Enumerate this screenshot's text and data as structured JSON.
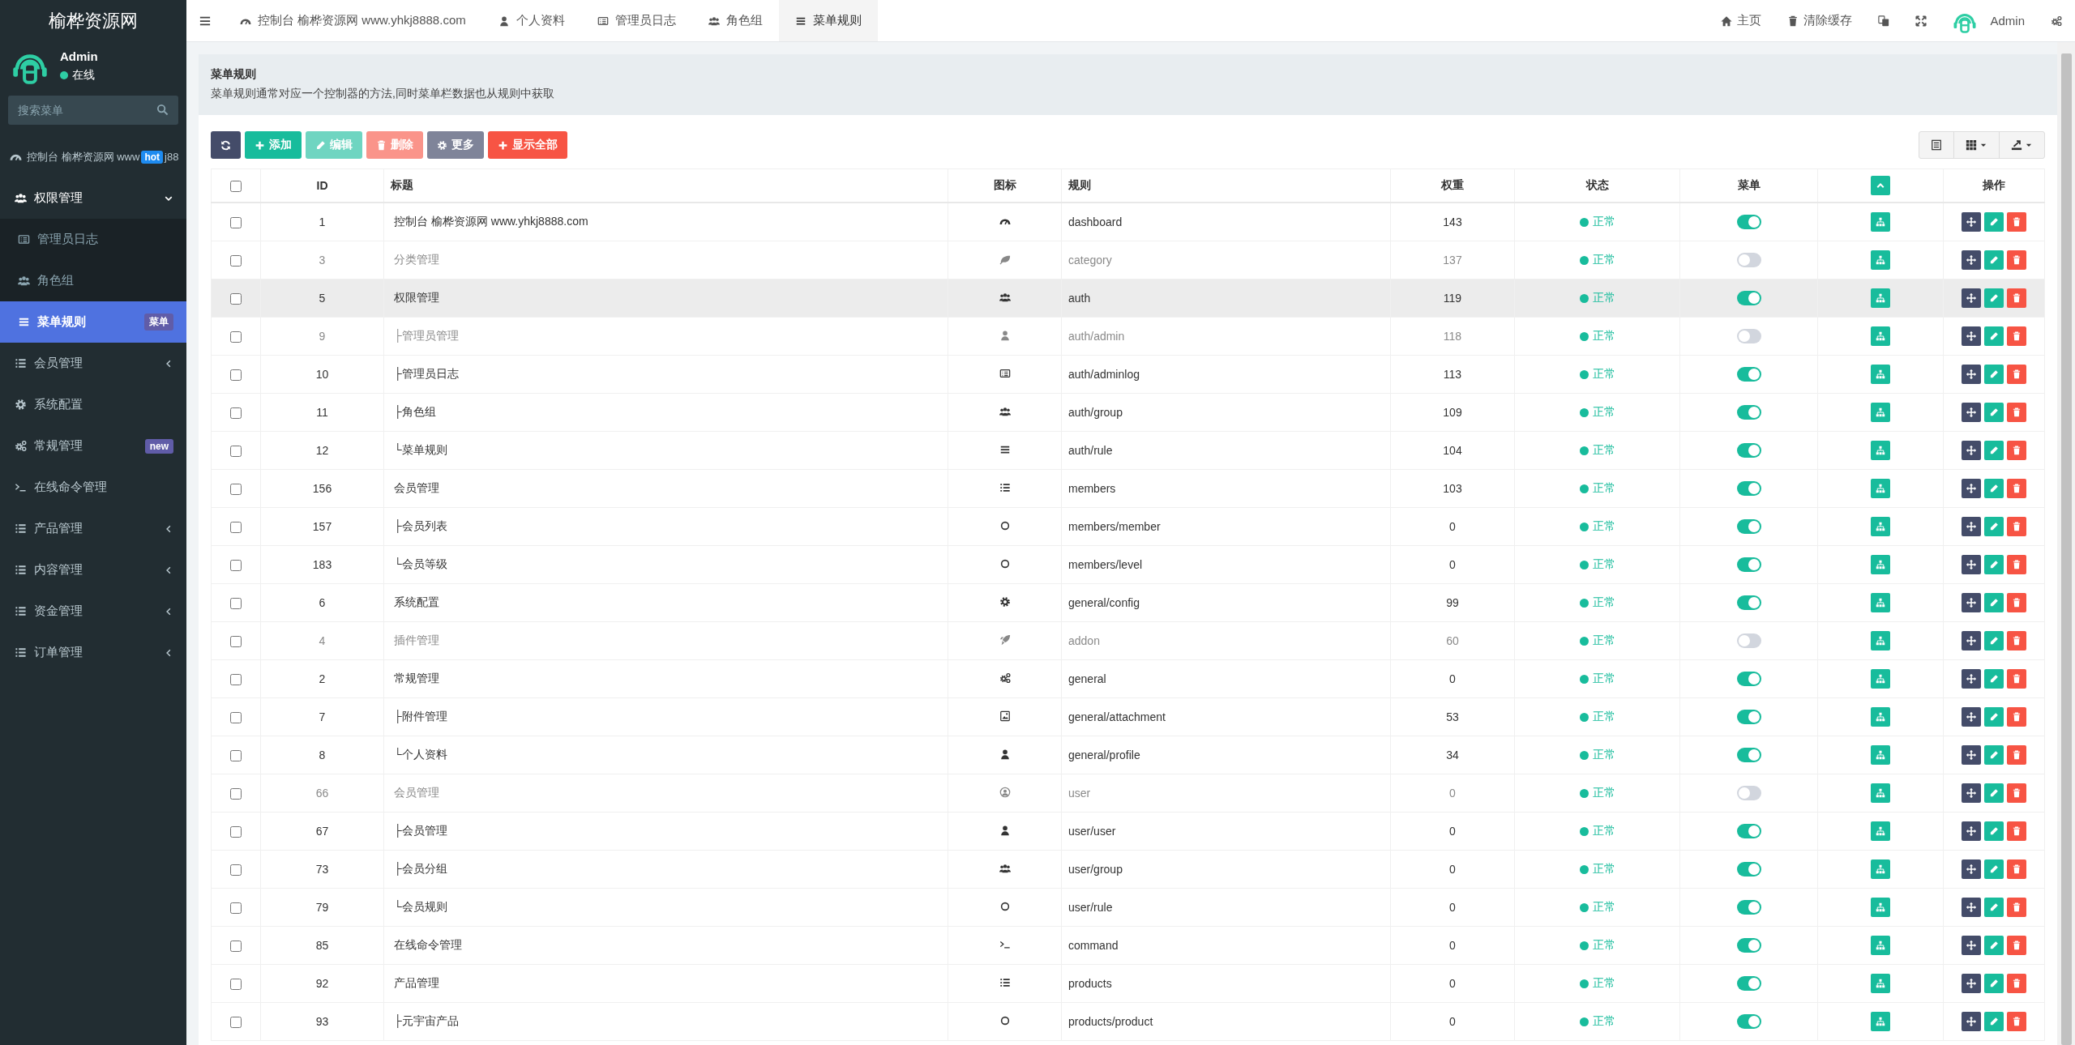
{
  "sidebar": {
    "brand": "榆桦资源网",
    "user": {
      "name": "Admin",
      "status": "在线"
    },
    "search": {
      "placeholder": "搜索菜单"
    },
    "items": [
      {
        "kind": "dashboard",
        "label": "控制台 榆桦资源网 www",
        "badge": {
          "text": "hot",
          "color": "#1e8bf0"
        },
        "label_tail": "j88",
        "selected": false
      },
      {
        "kind": "users",
        "label": "权限管理",
        "expanded": true,
        "selected": false,
        "children": [
          {
            "kind": "list-alt",
            "label": "管理员日志",
            "selected": false
          },
          {
            "kind": "users",
            "label": "角色组",
            "selected": false
          },
          {
            "kind": "bars",
            "label": "菜单规则",
            "selected": true,
            "badge": {
              "text": "菜单",
              "color": "#605ca8"
            }
          }
        ]
      },
      {
        "kind": "list",
        "label": "会员管理",
        "expanded": false,
        "selected": false
      },
      {
        "kind": "gear",
        "label": "系统配置",
        "selected": false
      },
      {
        "kind": "gears",
        "label": "常规管理",
        "selected": false,
        "badge": {
          "text": "new",
          "color": "#605ca8"
        }
      },
      {
        "kind": "terminal",
        "label": "在线命令管理",
        "selected": false
      },
      {
        "kind": "list",
        "label": "产品管理",
        "expanded": false,
        "selected": false
      },
      {
        "kind": "list",
        "label": "内容管理",
        "expanded": false,
        "selected": false
      },
      {
        "kind": "list",
        "label": "资金管理",
        "expanded": false,
        "selected": false
      },
      {
        "kind": "list",
        "label": "订单管理",
        "expanded": false,
        "selected": false
      }
    ]
  },
  "top_nav": {
    "tabs": [
      {
        "kind": "dashboard",
        "label": "控制台 榆桦资源网 www.yhkj8888.com",
        "selected": false
      },
      {
        "kind": "user",
        "label": "个人资料",
        "selected": false
      },
      {
        "kind": "list-alt",
        "label": "管理员日志",
        "selected": false
      },
      {
        "kind": "users",
        "label": "角色组",
        "selected": false
      },
      {
        "kind": "bars",
        "label": "菜单规则",
        "selected": true
      }
    ],
    "actions": [
      {
        "kind": "home",
        "label": "主页"
      },
      {
        "kind": "trash",
        "label": "清除缓存"
      },
      {
        "kind": "translate"
      },
      {
        "kind": "fullscreen"
      },
      {
        "kind": "avatar",
        "label": "Admin"
      },
      {
        "kind": "gears"
      }
    ]
  },
  "panel": {
    "title": "菜单规则",
    "description": "菜单规则通常对应一个控制器的方法,同时菜单栏数据也从规则中获取",
    "toolbar": [
      {
        "kind": "refresh",
        "disabled": false
      },
      {
        "kind": "add",
        "label": "添加",
        "disabled": false
      },
      {
        "kind": "edit",
        "label": "编辑",
        "disabled": true
      },
      {
        "kind": "delete",
        "label": "删除",
        "disabled": true
      },
      {
        "kind": "more",
        "label": "更多",
        "disabled": false
      },
      {
        "kind": "show-all",
        "label": "显示全部",
        "disabled": false
      }
    ],
    "view_tools": [
      {
        "kind": "view-list"
      },
      {
        "kind": "grid"
      },
      {
        "kind": "export"
      }
    ],
    "table": {
      "columns": [
        {
          "kind": "checkbox",
          "checked": false
        },
        {
          "kind": "text",
          "label": "ID"
        },
        {
          "kind": "text",
          "label": "标题"
        },
        {
          "kind": "text",
          "label": "图标"
        },
        {
          "kind": "text",
          "label": "规则"
        },
        {
          "kind": "text",
          "label": "权重"
        },
        {
          "kind": "text",
          "label": "状态"
        },
        {
          "kind": "text",
          "label": "菜单"
        },
        {
          "kind": "collapse-button"
        },
        {
          "kind": "text",
          "label": "操作"
        }
      ],
      "rows": [
        {
          "id": "1",
          "title": "控制台 榆桦资源网 www.yhkj8888.com",
          "kind": "dashboard",
          "rule": "dashboard",
          "weight": "143",
          "status": "正常",
          "menu": true,
          "checked": false,
          "highlighted": false
        },
        {
          "id": "3",
          "title": "分类管理",
          "kind": "leaf",
          "rule": "category",
          "weight": "137",
          "status": "正常",
          "menu": false,
          "checked": false,
          "highlighted": false
        },
        {
          "id": "5",
          "title": "权限管理",
          "kind": "users",
          "rule": "auth",
          "weight": "119",
          "status": "正常",
          "menu": true,
          "checked": false,
          "highlighted": true
        },
        {
          "id": "9",
          "title": "├管理员管理",
          "kind": "user",
          "rule": "auth/admin",
          "weight": "118",
          "status": "正常",
          "menu": false,
          "checked": false,
          "highlighted": false
        },
        {
          "id": "10",
          "title": "├管理员日志",
          "kind": "list-alt",
          "rule": "auth/adminlog",
          "weight": "113",
          "status": "正常",
          "menu": true,
          "checked": false,
          "highlighted": false
        },
        {
          "id": "11",
          "title": "├角色组",
          "kind": "users",
          "rule": "auth/group",
          "weight": "109",
          "status": "正常",
          "menu": true,
          "checked": false,
          "highlighted": false
        },
        {
          "id": "12",
          "title": "└菜单规则",
          "kind": "bars",
          "rule": "auth/rule",
          "weight": "104",
          "status": "正常",
          "menu": true,
          "checked": false,
          "highlighted": false
        },
        {
          "id": "156",
          "title": "会员管理",
          "kind": "list",
          "rule": "members",
          "weight": "103",
          "status": "正常",
          "menu": true,
          "checked": false,
          "highlighted": false
        },
        {
          "id": "157",
          "title": "├会员列表",
          "kind": "circle",
          "rule": "members/member",
          "weight": "0",
          "status": "正常",
          "menu": true,
          "checked": false,
          "highlighted": false
        },
        {
          "id": "183",
          "title": "└会员等级",
          "kind": "circle",
          "rule": "members/level",
          "weight": "0",
          "status": "正常",
          "menu": true,
          "checked": false,
          "highlighted": false
        },
        {
          "id": "6",
          "title": "系统配置",
          "kind": "gear",
          "rule": "general/config",
          "weight": "99",
          "status": "正常",
          "menu": true,
          "checked": false,
          "highlighted": false
        },
        {
          "id": "4",
          "title": "插件管理",
          "kind": "rocket",
          "rule": "addon",
          "weight": "60",
          "status": "正常",
          "menu": false,
          "checked": false,
          "highlighted": false
        },
        {
          "id": "2",
          "title": "常规管理",
          "kind": "gears",
          "rule": "general",
          "weight": "0",
          "status": "正常",
          "menu": true,
          "checked": false,
          "highlighted": false
        },
        {
          "id": "7",
          "title": "├附件管理",
          "kind": "image",
          "rule": "general/attachment",
          "weight": "53",
          "status": "正常",
          "menu": true,
          "checked": false,
          "highlighted": false
        },
        {
          "id": "8",
          "title": "└个人资料",
          "kind": "user",
          "rule": "general/profile",
          "weight": "34",
          "status": "正常",
          "menu": true,
          "checked": false,
          "highlighted": false
        },
        {
          "id": "66",
          "title": "会员管理",
          "kind": "user-circle",
          "rule": "user",
          "weight": "0",
          "status": "正常",
          "menu": false,
          "checked": false,
          "highlighted": false
        },
        {
          "id": "67",
          "title": "├会员管理",
          "kind": "user",
          "rule": "user/user",
          "weight": "0",
          "status": "正常",
          "menu": true,
          "checked": false,
          "highlighted": false
        },
        {
          "id": "73",
          "title": "├会员分组",
          "kind": "users",
          "rule": "user/group",
          "weight": "0",
          "status": "正常",
          "menu": true,
          "checked": false,
          "highlighted": false
        },
        {
          "id": "79",
          "title": "└会员规则",
          "kind": "circle",
          "rule": "user/rule",
          "weight": "0",
          "status": "正常",
          "menu": true,
          "checked": false,
          "highlighted": false
        },
        {
          "id": "85",
          "title": "在线命令管理",
          "kind": "terminal",
          "rule": "command",
          "weight": "0",
          "status": "正常",
          "menu": true,
          "checked": false,
          "highlighted": false
        },
        {
          "id": "92",
          "title": "产品管理",
          "kind": "list",
          "rule": "products",
          "weight": "0",
          "status": "正常",
          "menu": true,
          "checked": false,
          "highlighted": false
        },
        {
          "id": "93",
          "title": "├元宇宙产品",
          "kind": "circle",
          "rule": "products/product",
          "weight": "0",
          "status": "正常",
          "menu": true,
          "checked": false,
          "highlighted": false
        }
      ]
    }
  }
}
